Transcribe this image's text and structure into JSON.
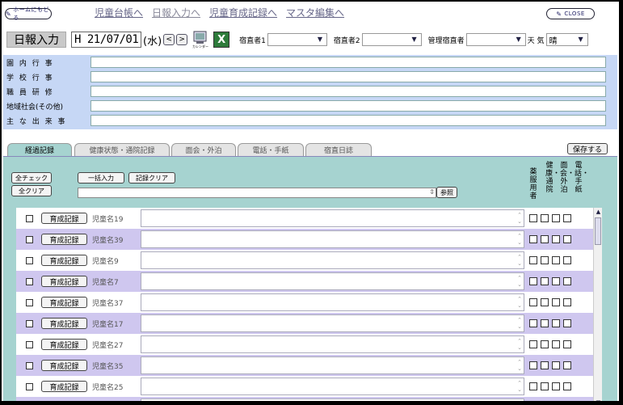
{
  "nav": {
    "home_label": "ホームにもどる",
    "links": [
      "児童台帳へ",
      "日報入力へ",
      "児童育成記録へ",
      "マスタ編集へ"
    ],
    "close_label": "CLOSE"
  },
  "header": {
    "title": "日報入力",
    "date": "H 21/07/01",
    "day_of_week": "(水)",
    "prev_label": "<",
    "next_label": ">",
    "calendar_label": "カレンダー",
    "excel_label": "X",
    "duty1_label": "宿直者1",
    "duty1_value": "",
    "duty2_label": "宿直者2",
    "duty2_value": "",
    "manager_label": "管理宿直者",
    "manager_value": "",
    "weather_label": "天 気",
    "weather_value": "晴"
  },
  "events": [
    {
      "label": "園 内 行 事",
      "value": ""
    },
    {
      "label": "学 校 行 事",
      "value": ""
    },
    {
      "label": "職 員 研 修",
      "value": ""
    },
    {
      "label": "地域社会(その他)",
      "value": ""
    },
    {
      "label": "主 な 出 来 事",
      "value": ""
    }
  ],
  "tabs": [
    "経過記録",
    "健康状態・通院記録",
    "面会・外泊",
    "電話・手紙",
    "宿直日誌"
  ],
  "active_tab": "経過記録",
  "save_label": "保存する",
  "panel": {
    "check_all": "全チェック",
    "clear_all": "全クリア",
    "bulk_input": "一括入力",
    "clear_records": "記録クリア",
    "reference": "参照",
    "col_headers": [
      "薬服用者",
      "健康・通院",
      "面会・外泊",
      "電話・手紙"
    ],
    "record_btn": "育成記録"
  },
  "children": [
    {
      "name": "児童名19"
    },
    {
      "name": "児童名39"
    },
    {
      "name": "児童名9"
    },
    {
      "name": "児童名7"
    },
    {
      "name": "児童名37"
    },
    {
      "name": "児童名17"
    },
    {
      "name": "児童名27"
    },
    {
      "name": "児童名35"
    },
    {
      "name": "児童名25"
    },
    {
      "name": ""
    }
  ],
  "colors": {
    "event_bg": "#c6d7f5",
    "panel_bg": "#a6d3d0",
    "row_alt": "#cfc7ef",
    "title_bg": "#c9c9c9"
  }
}
